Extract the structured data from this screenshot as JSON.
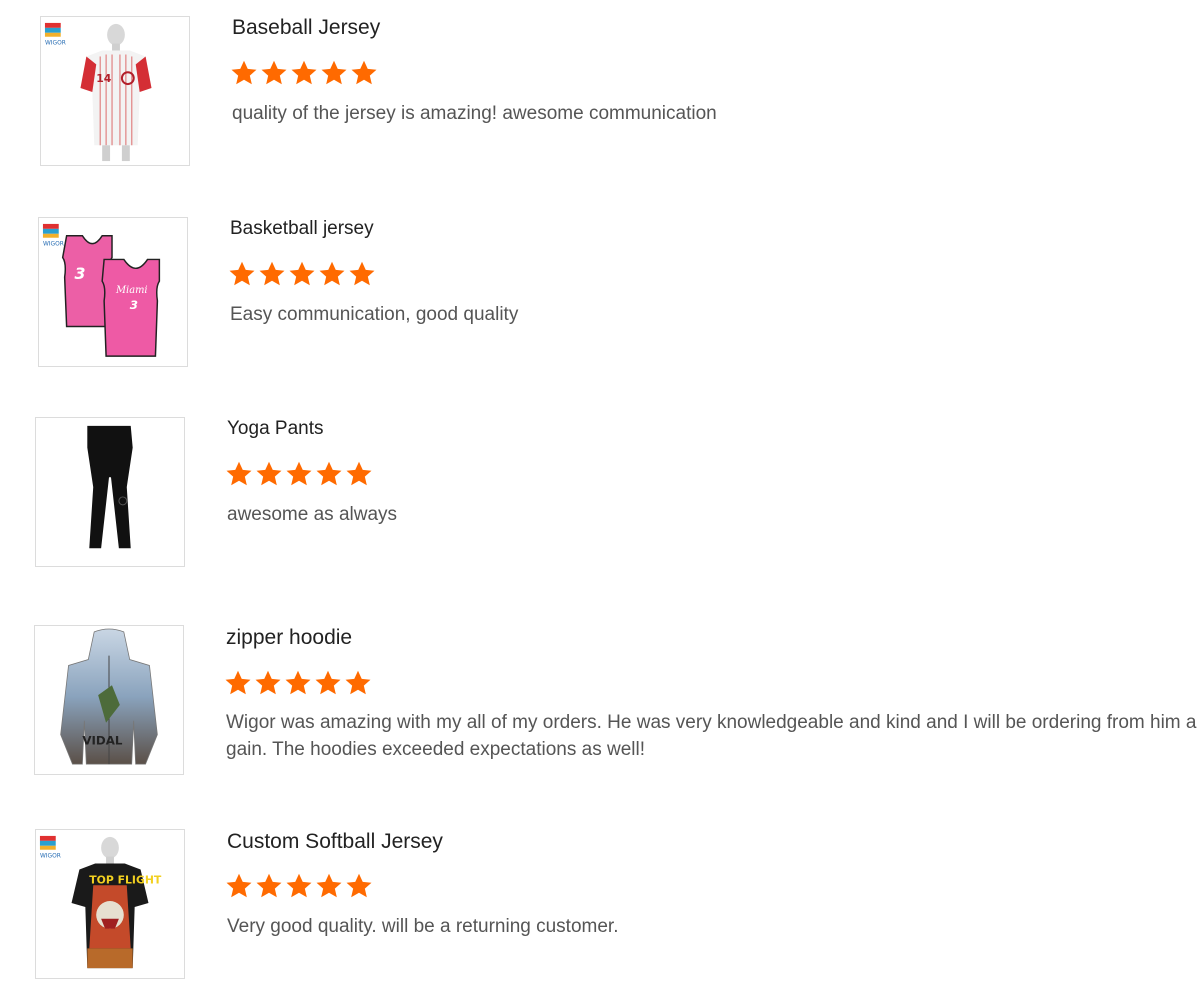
{
  "colors": {
    "star": "#ff6a00",
    "title": "#222222",
    "comment": "#555555",
    "border": "#dcdcdc"
  },
  "reviews": [
    {
      "title": "Baseball Jersey",
      "rating": 5,
      "comment": "quality of the jersey is amazing! awesome communication",
      "image_icon": "baseball-jersey-image"
    },
    {
      "title": "Basketball jersey",
      "rating": 5,
      "comment": "Easy communication, good quality",
      "image_icon": "basketball-jersey-image"
    },
    {
      "title": "Yoga Pants",
      "rating": 5,
      "comment": "awesome as always",
      "image_icon": "yoga-pants-image"
    },
    {
      "title": "zipper hoodie",
      "rating": 5,
      "comment": "Wigor was amazing with my all of my orders. He was very knowledgeable and kind and I will be ordering from him again. The hoodies exceeded expectations as well!",
      "image_icon": "zipper-hoodie-image"
    },
    {
      "title": "Custom Softball Jersey",
      "rating": 5,
      "comment": "Very good quality. will be a returning customer.",
      "image_icon": "softball-jersey-image"
    }
  ]
}
